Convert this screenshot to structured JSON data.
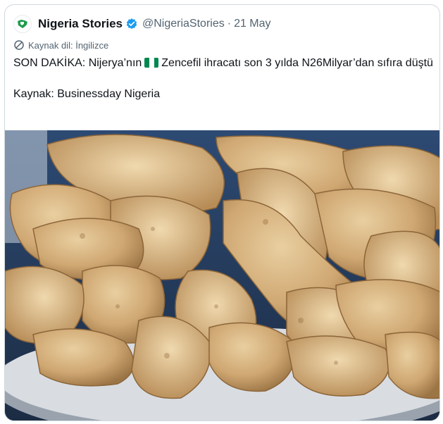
{
  "tweet": {
    "author_name": "Nigeria Stories",
    "handle": "@NigeriaStories",
    "separator": "·",
    "date": "21 May",
    "language_note": "Kaynak dil: İngilizce",
    "text_before_flag": "SON DAKİKA: Nijerya’nın",
    "text_after_flag": "Zencefil ihracatı son 3 yılda N26Milyar’dan sıfıra düştü",
    "source_line": "Kaynak: Businessday Nigeria"
  },
  "icons": {
    "avatar": "nigeria-map-logo",
    "verified": "verified-badge-icon",
    "translate": "translate-icon",
    "flag": "nigeria-flag-icon"
  },
  "colors": {
    "verified": "#1d9bf0",
    "flag_green": "#008751",
    "avatar_green": "#1e9c4a"
  }
}
